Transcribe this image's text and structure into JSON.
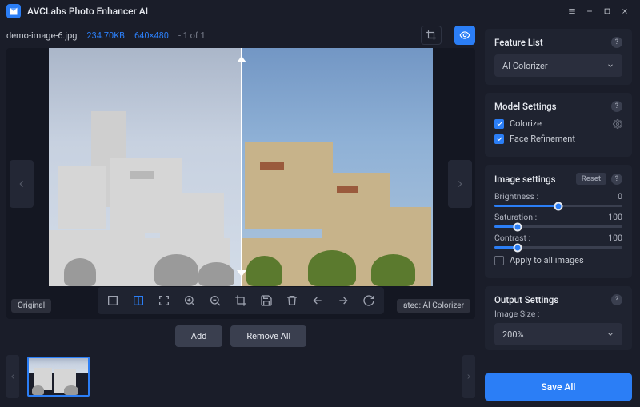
{
  "app": {
    "title": "AVCLabs Photo Enhancer AI"
  },
  "file": {
    "name": "demo-image-6.jpg",
    "size": "234.70KB",
    "dimensions": "640×480",
    "count": "- 1 of 1"
  },
  "canvas": {
    "original_label": "Original",
    "processed_label": "ated: AI Colorizer"
  },
  "actions": {
    "add": "Add",
    "remove_all": "Remove All"
  },
  "feature": {
    "header": "Feature List",
    "selected": "AI Colorizer"
  },
  "model": {
    "header": "Model Settings",
    "colorize": "Colorize",
    "face_refinement": "Face Refinement"
  },
  "image_settings": {
    "header": "Image settings",
    "reset": "Reset",
    "brightness_label": "Brightness :",
    "brightness_value": "0",
    "saturation_label": "Saturation :",
    "saturation_value": "100",
    "contrast_label": "Contrast :",
    "contrast_value": "100",
    "apply_all": "Apply to all images"
  },
  "output": {
    "header": "Output Settings",
    "size_label": "Image Size :",
    "size_value": "200%",
    "save_all": "Save All"
  }
}
